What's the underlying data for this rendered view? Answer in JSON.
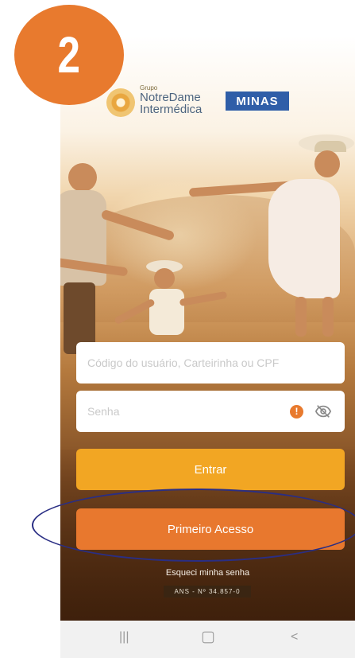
{
  "step": {
    "number": "2"
  },
  "brand": {
    "small_label": "Grupo",
    "name_line1": "NotreDame",
    "name_line2": "Intermédica",
    "region": "MINAS"
  },
  "login": {
    "user_placeholder": "Código do usuário, Carteirinha ou CPF",
    "password_placeholder": "Senha",
    "warning_symbol": "!"
  },
  "actions": {
    "enter_label": "Entrar",
    "first_access_label": "Primeiro Acesso",
    "forgot_password": "Esqueci minha senha"
  },
  "footer": {
    "ans_label": "ANS - Nº 34.857-0"
  },
  "navbar": {
    "recent": "|||",
    "home": "▢",
    "back": "<"
  },
  "colors": {
    "badge": "#e87a2e",
    "enter_button": "#f2a623",
    "first_access_button": "#e8782e",
    "minas_badge": "#2f5ea8",
    "highlight_outline": "#2a2e84"
  }
}
